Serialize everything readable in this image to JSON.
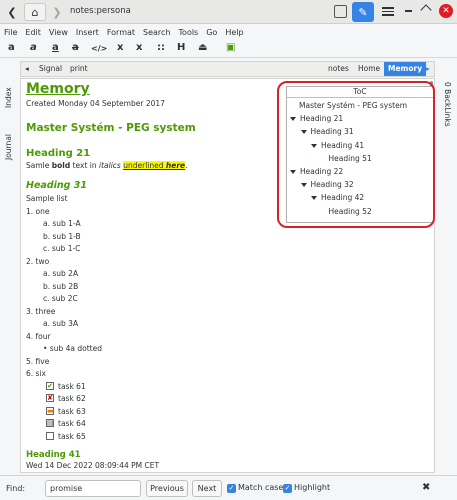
{
  "window": {
    "title": "notes:persona"
  },
  "menu": [
    "File",
    "Edit",
    "View",
    "Insert",
    "Format",
    "Search",
    "Tools",
    "Go",
    "Help"
  ],
  "toolbar": [
    "a",
    "a",
    "a",
    "a",
    "</>",
    "x",
    "x",
    "::",
    "H",
    "⏏",
    "▣"
  ],
  "pathbar": {
    "left_items": [
      "Signal",
      "print"
    ],
    "right_items": [
      "notes",
      "Home"
    ],
    "active": "Memory"
  },
  "side_tabs": {
    "left": [
      "Index",
      "Journal"
    ],
    "right": [
      "0 BackLinks"
    ]
  },
  "page": {
    "title": "Memory",
    "created": "Created Monday 04 September 2017",
    "heading1": "Master Systém - PEG system",
    "heading21": "Heading 21",
    "para": {
      "pre": "Samle ",
      "bold": "bold",
      "mid": " text in ",
      "ital": "italics",
      "sp": " ",
      "underl": "underlined",
      "sp2": " ",
      "here": "here",
      "end": "."
    },
    "heading31": "Heading 31",
    "sample_list": "Sample list",
    "list": [
      {
        "label": "1. one",
        "indent": 0
      },
      {
        "label": "a. sub 1-A",
        "indent": 1
      },
      {
        "label": "b. sub 1-B",
        "indent": 1
      },
      {
        "label": "c. sub 1-C",
        "indent": 1
      },
      {
        "label": "2. two",
        "indent": 0
      },
      {
        "label": "a. sub 2A",
        "indent": 1
      },
      {
        "label": "b. sub 2B",
        "indent": 1
      },
      {
        "label": "c. sub 2C",
        "indent": 1
      },
      {
        "label": "3. three",
        "indent": 0
      },
      {
        "label": "a. sub 3A",
        "indent": 1
      },
      {
        "label": "4. four",
        "indent": 0
      },
      {
        "label": "• sub 4a dotted",
        "indent": 1
      },
      {
        "label": "5. five",
        "indent": 0
      },
      {
        "label": "6. six",
        "indent": 0
      }
    ],
    "tasks": [
      {
        "label": "task 61",
        "state": "checked",
        "color": "#4e9a06"
      },
      {
        "label": "task 62",
        "state": "crossed",
        "color": "#cc0000"
      },
      {
        "label": "task 63",
        "state": "partial",
        "color": "#f57900"
      },
      {
        "label": "task 64",
        "state": "migrated",
        "color": "#555753"
      },
      {
        "label": "task 65",
        "state": "open",
        "color": "#888a85"
      }
    ],
    "heading41": "Heading 41",
    "heading41_date": "Wed 14 Dec 2022 08:09:44 PM CET"
  },
  "toc": {
    "title": "ToC",
    "items": [
      {
        "label": "Master Systém - PEG system",
        "level": 0,
        "expanded": false
      },
      {
        "label": "Heading 21",
        "level": 0,
        "expanded": true
      },
      {
        "label": "Heading 31",
        "level": 1,
        "expanded": true
      },
      {
        "label": "Heading 41",
        "level": 2,
        "expanded": true
      },
      {
        "label": "Heading 51",
        "level": 3,
        "expanded": false
      },
      {
        "label": "Heading 22",
        "level": 0,
        "expanded": true
      },
      {
        "label": "Heading 32",
        "level": 1,
        "expanded": true
      },
      {
        "label": "Heading 42",
        "level": 2,
        "expanded": true
      },
      {
        "label": "Heading 52",
        "level": 3,
        "expanded": false
      }
    ]
  },
  "findbar": {
    "label": "Find:",
    "value": "promise",
    "previous": "Previous",
    "next": "Next",
    "match_case": "Match case",
    "highlight": "Highlight"
  },
  "colors": {
    "accent": "#3584e4",
    "heading": "#4e9a06",
    "highlight": "#fcf803",
    "annotation": "#d8222a"
  }
}
